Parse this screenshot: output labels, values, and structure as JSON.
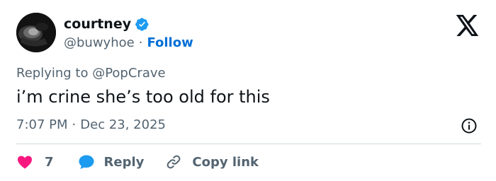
{
  "author": {
    "display_name": "courtney",
    "handle": "@buwyhoe",
    "separator": "·",
    "follow_label": "Follow",
    "verified": true,
    "verified_color": "#1d9bf0"
  },
  "tweet": {
    "replying_prefix": "Replying to ",
    "replying_mention": "@PopCrave",
    "text": "i’m crine she’s too old for this",
    "time": "7:07 PM",
    "separator": "·",
    "date": "Dec 23, 2025"
  },
  "actions": {
    "like_count": "7",
    "like_icon": "heart-icon",
    "like_color": "#f91880",
    "reply_label": "Reply",
    "reply_icon": "speech-bubble-icon",
    "reply_color": "#1d9bf0",
    "copy_label": "Copy link",
    "copy_icon": "link-icon"
  },
  "icons": {
    "brand": "x-logo-icon",
    "info": "info-icon"
  },
  "colors": {
    "text": "#0f1419",
    "secondary": "#536471",
    "link": "#006fd6",
    "divider": "#cfd9de"
  }
}
